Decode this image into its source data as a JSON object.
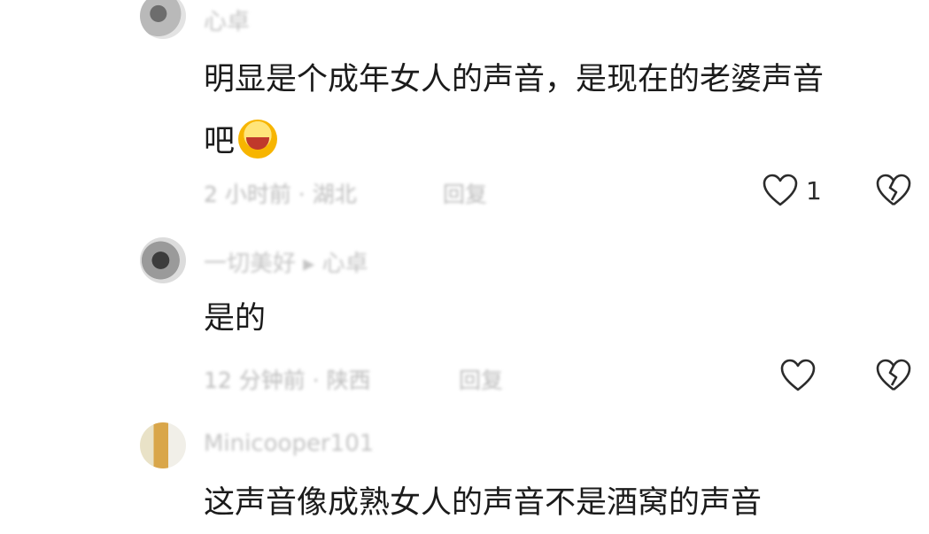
{
  "comments": [
    {
      "username": "心卓",
      "lines": [
        "明显是个成年女人的声音，是现在的老婆声音",
        "吧"
      ],
      "emoji": "laughing-crying-emoji",
      "meta": "2 小时前 · 湖北",
      "reply_label": "回复",
      "like_count": "1"
    },
    {
      "username": "一切美好 ▸ 心卓",
      "lines": [
        "是的"
      ],
      "meta": "12 分钟前 · 陕西",
      "reply_label": "回复",
      "like_count": ""
    },
    {
      "username": "Minicooper101",
      "lines": [
        "这声音像成熟女人的声音不是酒窝的声音"
      ]
    }
  ],
  "icons": {
    "like": "heart-outline-icon",
    "dislike": "broken-heart-icon"
  },
  "colors": {
    "text": "#1b1b1b",
    "muted": "#bcbcbc",
    "icon": "#2b2b2b"
  }
}
